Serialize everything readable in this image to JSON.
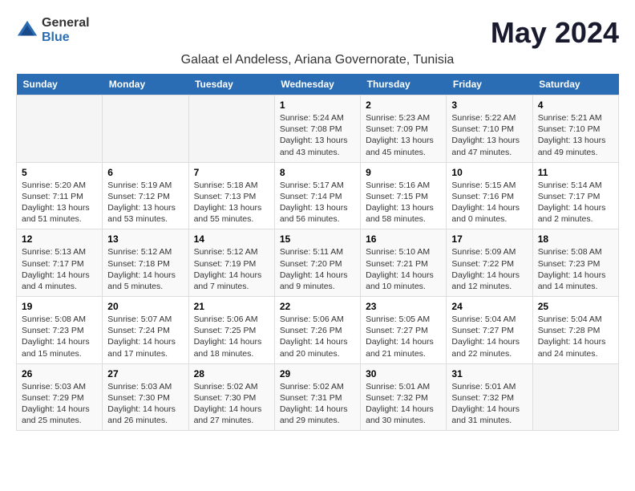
{
  "logo": {
    "general": "General",
    "blue": "Blue"
  },
  "title": "May 2024",
  "location": "Galaat el Andeless, Ariana Governorate, Tunisia",
  "weekdays": [
    "Sunday",
    "Monday",
    "Tuesday",
    "Wednesday",
    "Thursday",
    "Friday",
    "Saturday"
  ],
  "weeks": [
    [
      {
        "day": "",
        "info": ""
      },
      {
        "day": "",
        "info": ""
      },
      {
        "day": "",
        "info": ""
      },
      {
        "day": "1",
        "info": "Sunrise: 5:24 AM\nSunset: 7:08 PM\nDaylight: 13 hours and 43 minutes."
      },
      {
        "day": "2",
        "info": "Sunrise: 5:23 AM\nSunset: 7:09 PM\nDaylight: 13 hours and 45 minutes."
      },
      {
        "day": "3",
        "info": "Sunrise: 5:22 AM\nSunset: 7:10 PM\nDaylight: 13 hours and 47 minutes."
      },
      {
        "day": "4",
        "info": "Sunrise: 5:21 AM\nSunset: 7:10 PM\nDaylight: 13 hours and 49 minutes."
      }
    ],
    [
      {
        "day": "5",
        "info": "Sunrise: 5:20 AM\nSunset: 7:11 PM\nDaylight: 13 hours and 51 minutes."
      },
      {
        "day": "6",
        "info": "Sunrise: 5:19 AM\nSunset: 7:12 PM\nDaylight: 13 hours and 53 minutes."
      },
      {
        "day": "7",
        "info": "Sunrise: 5:18 AM\nSunset: 7:13 PM\nDaylight: 13 hours and 55 minutes."
      },
      {
        "day": "8",
        "info": "Sunrise: 5:17 AM\nSunset: 7:14 PM\nDaylight: 13 hours and 56 minutes."
      },
      {
        "day": "9",
        "info": "Sunrise: 5:16 AM\nSunset: 7:15 PM\nDaylight: 13 hours and 58 minutes."
      },
      {
        "day": "10",
        "info": "Sunrise: 5:15 AM\nSunset: 7:16 PM\nDaylight: 14 hours and 0 minutes."
      },
      {
        "day": "11",
        "info": "Sunrise: 5:14 AM\nSunset: 7:17 PM\nDaylight: 14 hours and 2 minutes."
      }
    ],
    [
      {
        "day": "12",
        "info": "Sunrise: 5:13 AM\nSunset: 7:17 PM\nDaylight: 14 hours and 4 minutes."
      },
      {
        "day": "13",
        "info": "Sunrise: 5:12 AM\nSunset: 7:18 PM\nDaylight: 14 hours and 5 minutes."
      },
      {
        "day": "14",
        "info": "Sunrise: 5:12 AM\nSunset: 7:19 PM\nDaylight: 14 hours and 7 minutes."
      },
      {
        "day": "15",
        "info": "Sunrise: 5:11 AM\nSunset: 7:20 PM\nDaylight: 14 hours and 9 minutes."
      },
      {
        "day": "16",
        "info": "Sunrise: 5:10 AM\nSunset: 7:21 PM\nDaylight: 14 hours and 10 minutes."
      },
      {
        "day": "17",
        "info": "Sunrise: 5:09 AM\nSunset: 7:22 PM\nDaylight: 14 hours and 12 minutes."
      },
      {
        "day": "18",
        "info": "Sunrise: 5:08 AM\nSunset: 7:23 PM\nDaylight: 14 hours and 14 minutes."
      }
    ],
    [
      {
        "day": "19",
        "info": "Sunrise: 5:08 AM\nSunset: 7:23 PM\nDaylight: 14 hours and 15 minutes."
      },
      {
        "day": "20",
        "info": "Sunrise: 5:07 AM\nSunset: 7:24 PM\nDaylight: 14 hours and 17 minutes."
      },
      {
        "day": "21",
        "info": "Sunrise: 5:06 AM\nSunset: 7:25 PM\nDaylight: 14 hours and 18 minutes."
      },
      {
        "day": "22",
        "info": "Sunrise: 5:06 AM\nSunset: 7:26 PM\nDaylight: 14 hours and 20 minutes."
      },
      {
        "day": "23",
        "info": "Sunrise: 5:05 AM\nSunset: 7:27 PM\nDaylight: 14 hours and 21 minutes."
      },
      {
        "day": "24",
        "info": "Sunrise: 5:04 AM\nSunset: 7:27 PM\nDaylight: 14 hours and 22 minutes."
      },
      {
        "day": "25",
        "info": "Sunrise: 5:04 AM\nSunset: 7:28 PM\nDaylight: 14 hours and 24 minutes."
      }
    ],
    [
      {
        "day": "26",
        "info": "Sunrise: 5:03 AM\nSunset: 7:29 PM\nDaylight: 14 hours and 25 minutes."
      },
      {
        "day": "27",
        "info": "Sunrise: 5:03 AM\nSunset: 7:30 PM\nDaylight: 14 hours and 26 minutes."
      },
      {
        "day": "28",
        "info": "Sunrise: 5:02 AM\nSunset: 7:30 PM\nDaylight: 14 hours and 27 minutes."
      },
      {
        "day": "29",
        "info": "Sunrise: 5:02 AM\nSunset: 7:31 PM\nDaylight: 14 hours and 29 minutes."
      },
      {
        "day": "30",
        "info": "Sunrise: 5:01 AM\nSunset: 7:32 PM\nDaylight: 14 hours and 30 minutes."
      },
      {
        "day": "31",
        "info": "Sunrise: 5:01 AM\nSunset: 7:32 PM\nDaylight: 14 hours and 31 minutes."
      },
      {
        "day": "",
        "info": ""
      }
    ]
  ]
}
